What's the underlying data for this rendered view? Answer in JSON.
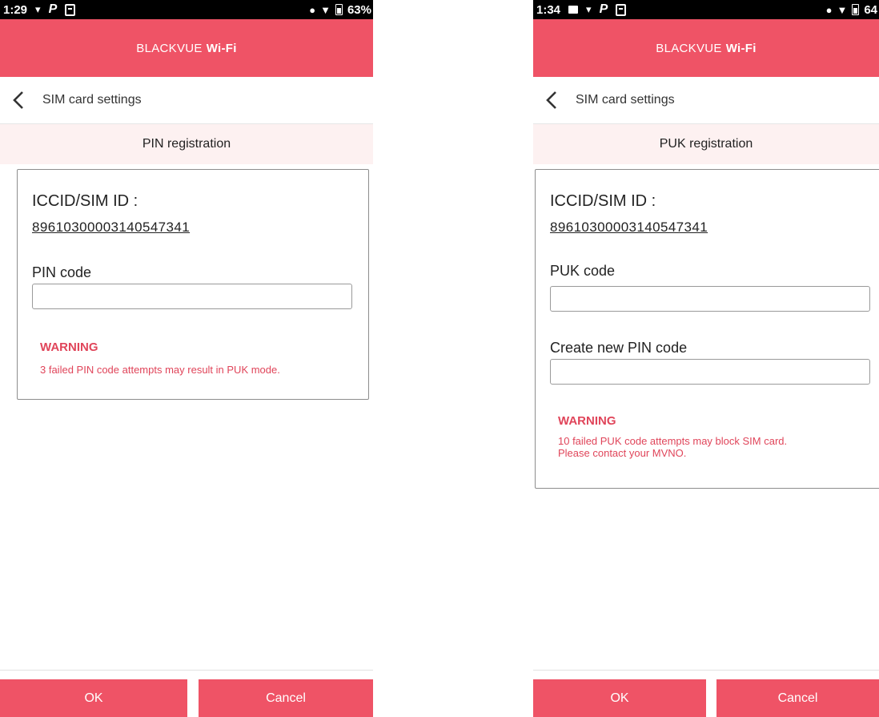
{
  "left": {
    "status": {
      "time": "1:29",
      "battery": "63%"
    },
    "app_title": {
      "brand": "BLACKVUE",
      "wifi": "Wi-Fi"
    },
    "nav_title": "SIM card settings",
    "section_title": "PIN registration",
    "iccid_label": "ICCID/SIM ID :",
    "iccid_value": "89610300003140547341",
    "pin_label": "PIN code",
    "pin_value": "",
    "warning_title": "WARNING",
    "warning_text": "3 failed PIN code attempts may result in PUK mode.",
    "ok_label": "OK",
    "cancel_label": "Cancel"
  },
  "right": {
    "status": {
      "time": "1:34",
      "battery": "64"
    },
    "app_title": {
      "brand": "BLACKVUE",
      "wifi": "Wi-Fi"
    },
    "nav_title": "SIM card settings",
    "section_title": "PUK registration",
    "iccid_label": "ICCID/SIM ID :",
    "iccid_value": "89610300003140547341",
    "puk_label": "PUK code",
    "puk_value": "",
    "new_pin_label": "Create new PIN code",
    "new_pin_value": "",
    "warning_title": "WARNING",
    "warning_line1": "10 failed PUK code attempts may block SIM card.",
    "warning_line2": "Please contact your MVNO.",
    "ok_label": "OK",
    "cancel_label": "Cancel"
  },
  "colors": {
    "accent": "#ef5366",
    "warning": "#e0455a",
    "section_bg": "#fdf1f1"
  },
  "icons": [
    "back-arrow-icon",
    "wifi-icon",
    "vibrate-icon",
    "battery-icon",
    "parking-icon",
    "image-icon"
  ]
}
